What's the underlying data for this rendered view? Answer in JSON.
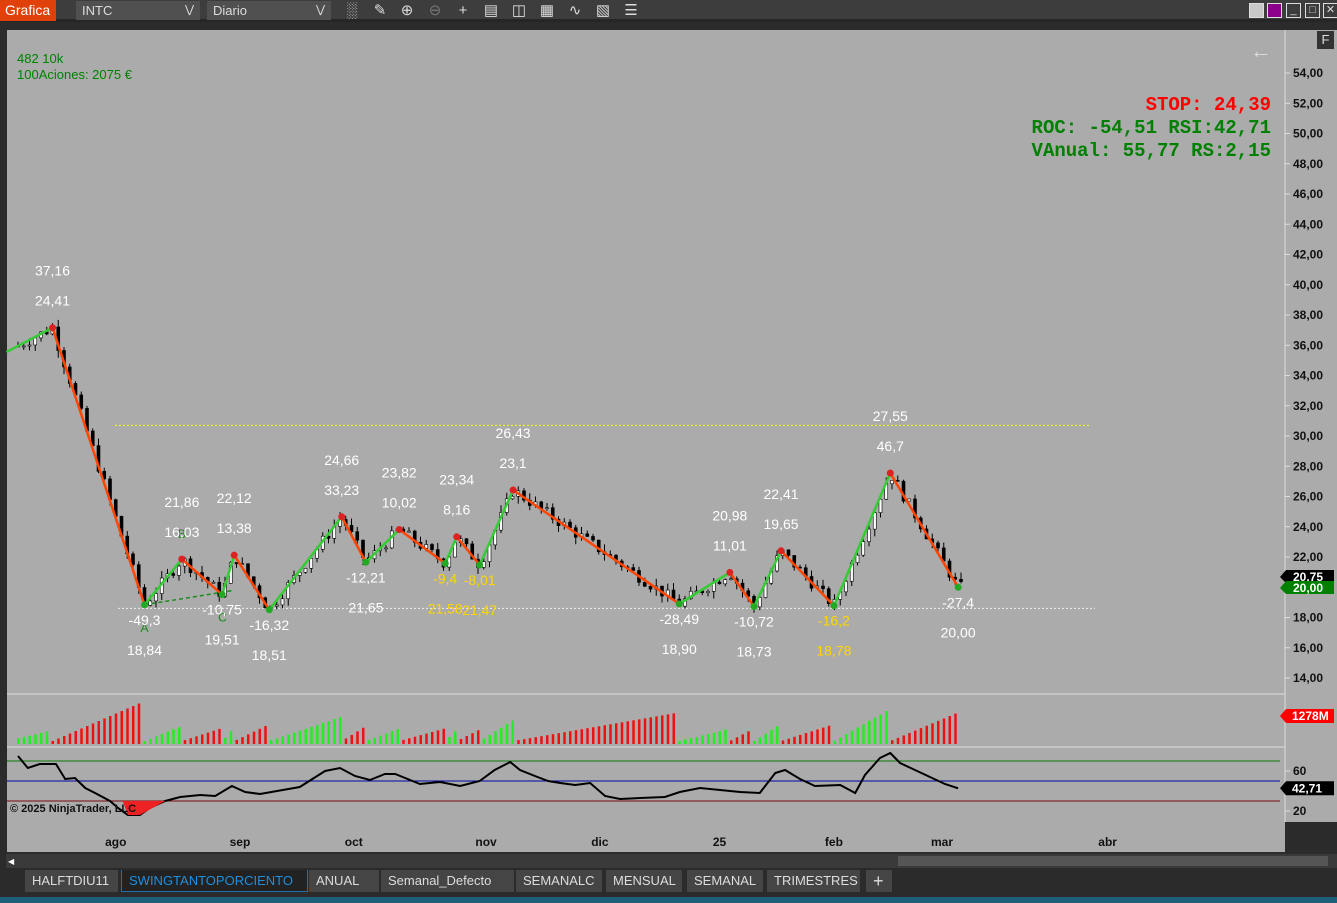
{
  "toolbar": {
    "title": "Grafica",
    "instrument": "INTC",
    "period": "Diario",
    "icons": [
      "bar-chart-icon",
      "pencil-icon",
      "zoom-in-icon",
      "zoom-out-icon",
      "crosshair-icon",
      "data-box-icon",
      "chart-trader-icon",
      "properties-icon",
      "strategy-icon",
      "calculator-icon",
      "list-icon"
    ],
    "window_buttons": [
      "gray-theme-icon",
      "purple-theme-icon",
      "minimize-icon",
      "maximize-icon",
      "close-icon"
    ]
  },
  "chart": {
    "info_line1": "482 10k",
    "info_line2": "100Aciones: 2075 €",
    "stop": "STOP: 24,39",
    "roc_rsi": "ROC: -54,51 RSI:42,71",
    "vanual_rs": "VAnual: 55,77 RS:2,15",
    "f_button": "F",
    "copyright": "© 2025 NinjaTrader, LLC",
    "price_axis": [
      "54,00",
      "52,00",
      "50,00",
      "48,00",
      "46,00",
      "44,00",
      "42,00",
      "40,00",
      "38,00",
      "36,00",
      "34,00",
      "32,00",
      "30,00",
      "28,00",
      "26,00",
      "24,00",
      "22,00",
      "20,00",
      "18,00",
      "16,00",
      "14,00"
    ],
    "price_markers": [
      {
        "label": "20,75",
        "color": "#000000"
      },
      {
        "label": "20,00",
        "color": "#008000"
      }
    ],
    "volume_marker": {
      "label": "1278M",
      "color": "#ff0000"
    },
    "rsi_axis": [
      "60",
      "20"
    ],
    "rsi_marker": {
      "label": "42,71",
      "color": "#000000"
    },
    "rsi_levels": [
      70,
      50,
      30
    ],
    "yellow_line_price": 30.7,
    "white_line_price": 18.6,
    "x_ticks": [
      {
        "label": "ago",
        "bar": 17
      },
      {
        "label": "sep",
        "bar": 38.6
      },
      {
        "label": "oct",
        "bar": 58.4
      },
      {
        "label": "nov",
        "bar": 81.4
      },
      {
        "label": "dic",
        "bar": 101.2
      },
      {
        "label": "25",
        "bar": 122
      },
      {
        "label": "feb",
        "bar": 141.9
      },
      {
        "label": "mar",
        "bar": 160.7
      },
      {
        "label": "abr",
        "bar": 189.5
      }
    ],
    "abc_labels": [
      "A",
      "B",
      "C"
    ],
    "zigzag_start": {
      "bar": -2,
      "price": 35.55
    },
    "pivots": [
      {
        "bar": 6,
        "price": 37.16,
        "price_label": "37,16",
        "pct": "24,41",
        "type": "high",
        "color": "#ffffff"
      },
      {
        "bar": 22,
        "price": 18.84,
        "price_label": "18,84",
        "pct": "-49,3",
        "type": "low",
        "color": "#ffffff"
      },
      {
        "bar": 28.5,
        "price": 21.86,
        "price_label": "21,86",
        "pct": "16,03",
        "type": "high",
        "color": "#ffffff"
      },
      {
        "bar": 35.5,
        "price": 19.51,
        "price_label": "19,51",
        "pct": "-10,75",
        "type": "low",
        "color": "#ffffff"
      },
      {
        "bar": 37.6,
        "price": 22.12,
        "price_label": "22,12",
        "pct": "13,38",
        "type": "high",
        "color": "#ffffff"
      },
      {
        "bar": 43.7,
        "price": 18.51,
        "price_label": "18,51",
        "pct": "-16,32",
        "type": "low",
        "color": "#ffffff"
      },
      {
        "bar": 56.3,
        "price": 24.66,
        "price_label": "24,66",
        "pct": "33,23",
        "type": "high",
        "color": "#ffffff"
      },
      {
        "bar": 60.5,
        "price": 21.65,
        "price_label": "21,65",
        "pct": "-12,21",
        "type": "low",
        "color": "#ffffff"
      },
      {
        "bar": 66.3,
        "price": 23.82,
        "price_label": "23,82",
        "pct": "10,02",
        "type": "high",
        "color": "#ffffff"
      },
      {
        "bar": 74.3,
        "price": 21.58,
        "price_label": "21,58",
        "pct": "-9,4",
        "type": "low",
        "color": "#ffd700"
      },
      {
        "bar": 76.3,
        "price": 23.34,
        "price_label": "23,34",
        "pct": "8,16",
        "type": "high",
        "color": "#ffffff"
      },
      {
        "bar": 80.3,
        "price": 21.47,
        "price_label": "21,47",
        "pct": "-8,01",
        "type": "low",
        "color": "#ffd700"
      },
      {
        "bar": 86.1,
        "price": 26.43,
        "price_label": "26,43",
        "pct": "23,1",
        "type": "high",
        "color": "#ffffff"
      },
      {
        "bar": 115,
        "price": 18.9,
        "price_label": "18,90",
        "pct": "-28,49",
        "type": "low",
        "color": "#ffffff"
      },
      {
        "bar": 123.8,
        "price": 20.98,
        "price_label": "20,98",
        "pct": "11,01",
        "type": "high",
        "color": "#ffffff"
      },
      {
        "bar": 128,
        "price": 18.73,
        "price_label": "18,73",
        "pct": "-10,72",
        "type": "low",
        "color": "#ffffff"
      },
      {
        "bar": 132.7,
        "price": 22.41,
        "price_label": "22,41",
        "pct": "19,65",
        "type": "high",
        "color": "#ffffff"
      },
      {
        "bar": 141.9,
        "price": 18.78,
        "price_label": "18,78",
        "pct": "-16,2",
        "type": "low",
        "color": "#ffd700"
      },
      {
        "bar": 151.7,
        "price": 27.55,
        "price_label": "27,55",
        "pct": "46,7",
        "type": "high",
        "color": "#ffffff"
      },
      {
        "bar": 163.5,
        "price": 20.0,
        "price_label": "20,00",
        "pct": "-27,4",
        "type": "low",
        "color": "#ffffff"
      }
    ],
    "rsi": [
      [
        0,
        75
      ],
      [
        1.7,
        63
      ],
      [
        3.8,
        67
      ],
      [
        6.6,
        67
      ],
      [
        8.2,
        52
      ],
      [
        9.9,
        53
      ],
      [
        11.7,
        43
      ],
      [
        13.4,
        38
      ],
      [
        16,
        30
      ],
      [
        17.4,
        23
      ],
      [
        19.1,
        16
      ],
      [
        21.2,
        16
      ],
      [
        22.9,
        23
      ],
      [
        25.6,
        30
      ],
      [
        28.2,
        34
      ],
      [
        31.7,
        36
      ],
      [
        34.3,
        35
      ],
      [
        37.2,
        45
      ],
      [
        39.5,
        39
      ],
      [
        42.1,
        37
      ],
      [
        49,
        44
      ],
      [
        53.4,
        60
      ],
      [
        56,
        63
      ],
      [
        58.6,
        55
      ],
      [
        61.2,
        51
      ],
      [
        63.8,
        57
      ],
      [
        65.6,
        57
      ],
      [
        69.9,
        47
      ],
      [
        73.4,
        49
      ],
      [
        76.9,
        45
      ],
      [
        80.3,
        50
      ],
      [
        82.9,
        61
      ],
      [
        85.6,
        69
      ],
      [
        87.3,
        61
      ],
      [
        89.9,
        55
      ],
      [
        92.2,
        50
      ],
      [
        94.3,
        48
      ],
      [
        96.9,
        46
      ],
      [
        99.5,
        48
      ],
      [
        102.1,
        35
      ],
      [
        104.7,
        32
      ],
      [
        108.2,
        33
      ],
      [
        112.5,
        34
      ],
      [
        115.1,
        39
      ],
      [
        118.6,
        43
      ],
      [
        122.1,
        41
      ],
      [
        125.6,
        39
      ],
      [
        129,
        38
      ],
      [
        131.7,
        58
      ],
      [
        133.4,
        61
      ],
      [
        136,
        52
      ],
      [
        138.6,
        45
      ],
      [
        143,
        46
      ],
      [
        145.6,
        38
      ],
      [
        147.3,
        56
      ],
      [
        149.9,
        73
      ],
      [
        151.7,
        78
      ],
      [
        153.4,
        68
      ],
      [
        156,
        61
      ],
      [
        158.6,
        54
      ],
      [
        161.2,
        47
      ],
      [
        163.5,
        42.71
      ]
    ]
  },
  "tabs": [
    {
      "label": "HALFTDIU11"
    },
    {
      "label": "SWINGTANTOPORCIENTO",
      "active": true
    },
    {
      "label": "ANUAL"
    },
    {
      "label": "Semanal_Defecto"
    },
    {
      "label": "SEMANALC"
    },
    {
      "label": "MENSUAL"
    },
    {
      "label": "SEMANAL"
    },
    {
      "label": "TRIMESTRES"
    }
  ],
  "add_tab": "+",
  "colors": {
    "up": "#33cc33",
    "down": "#ff4500",
    "background": "#ababab",
    "accent": "#e0400a",
    "active_tab": "#1e8fe0"
  }
}
